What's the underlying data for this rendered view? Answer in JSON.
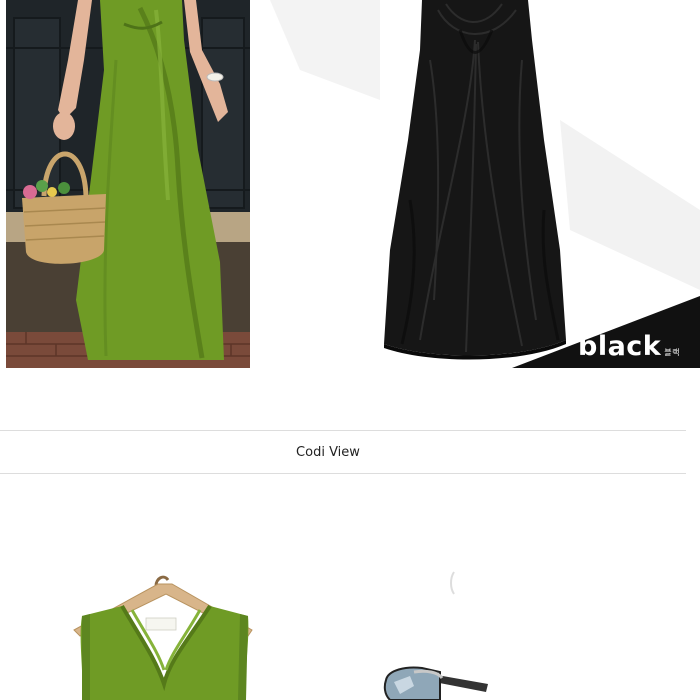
{
  "product_photos": {
    "left": {
      "subject": "green-dress-model-with-basket-photo"
    },
    "right": {
      "subject": "black-dress-photo",
      "color_label": "black",
      "color_label_sub": "블랙"
    }
  },
  "codi": {
    "title": "Codi View"
  },
  "styling_photos": {
    "hanger": {
      "subject": "green-top-on-hanger-photo"
    },
    "glasses": {
      "subject": "sunglasses-photo"
    }
  },
  "colors": {
    "dress_green": "#6f9b25",
    "dress_black": "#161616",
    "wall": "#1e2428"
  }
}
